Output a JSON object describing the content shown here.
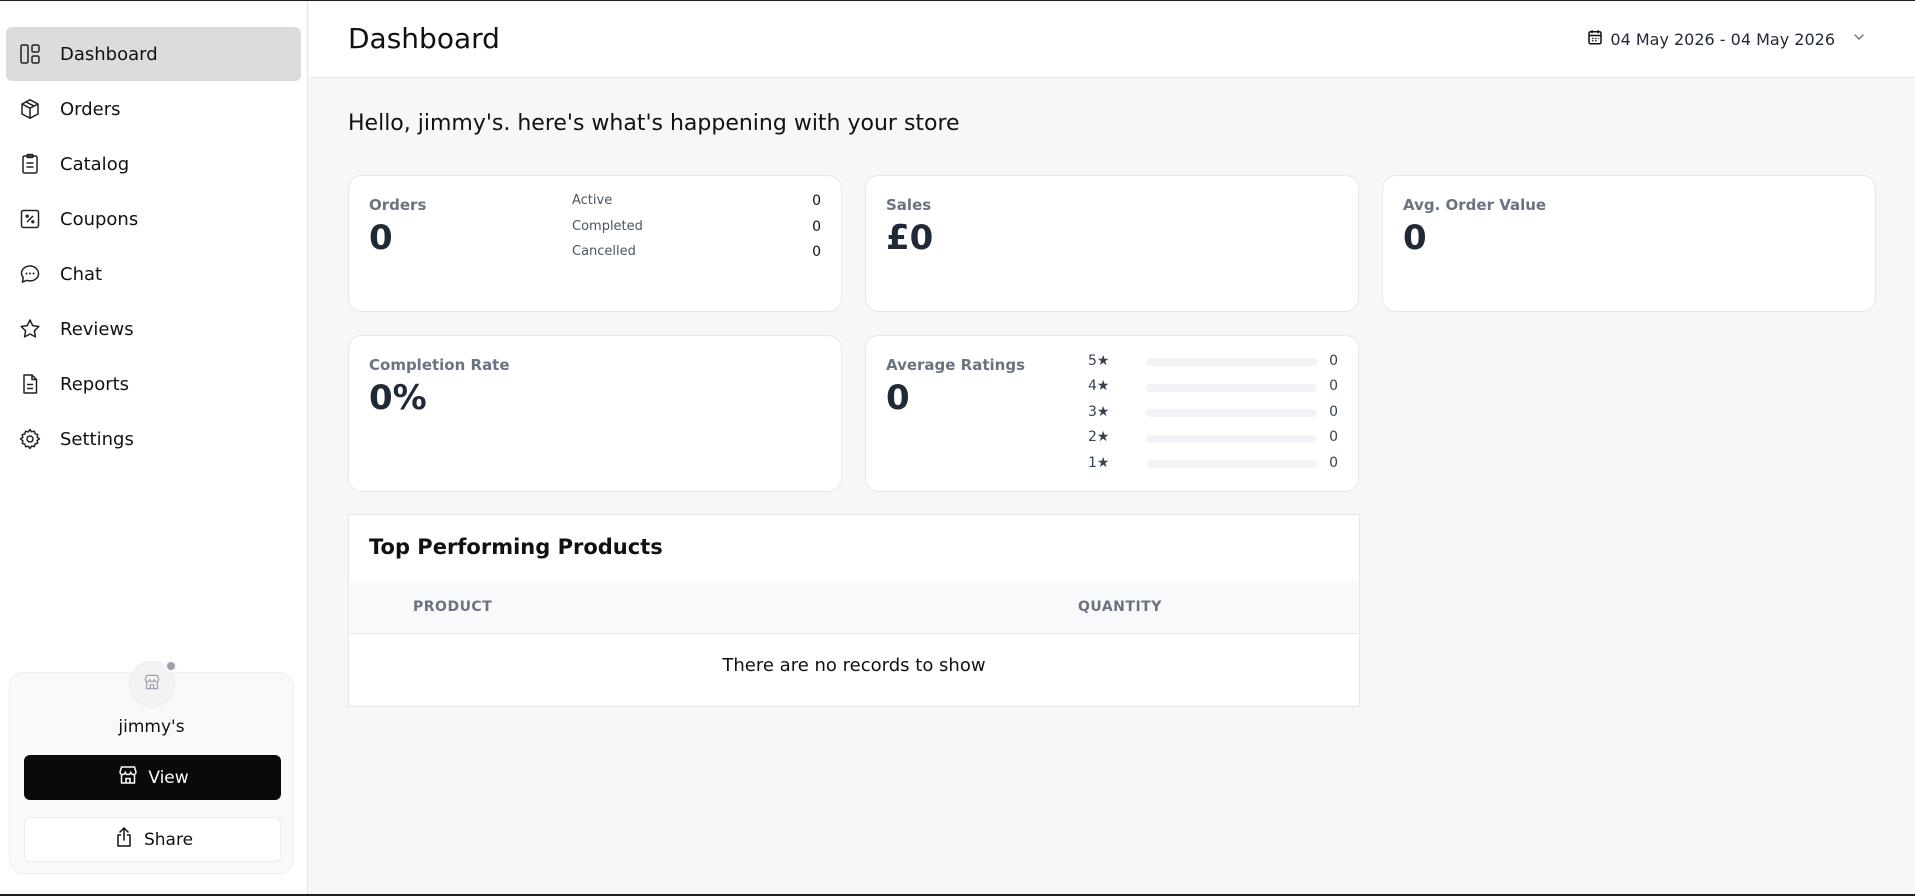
{
  "sidebar": {
    "items": [
      {
        "label": "Dashboard",
        "icon": "dashboard-icon",
        "active": true
      },
      {
        "label": "Orders",
        "icon": "box-icon"
      },
      {
        "label": "Catalog",
        "icon": "clipboard-icon"
      },
      {
        "label": "Coupons",
        "icon": "percent-icon"
      },
      {
        "label": "Chat",
        "icon": "chat-icon"
      },
      {
        "label": "Reviews",
        "icon": "star-icon"
      },
      {
        "label": "Reports",
        "icon": "document-icon"
      },
      {
        "label": "Settings",
        "icon": "gear-icon"
      }
    ],
    "store": {
      "name": "jimmy's",
      "view_label": "View",
      "share_label": "Share"
    }
  },
  "header": {
    "title": "Dashboard",
    "date_range": "04 May 2026 - 04 May 2026"
  },
  "greeting": "Hello, jimmy's. here's what's happening with your store",
  "stats": {
    "orders": {
      "label": "Orders",
      "value": "0",
      "breakdown": [
        {
          "label": "Active",
          "value": "0"
        },
        {
          "label": "Completed",
          "value": "0"
        },
        {
          "label": "Cancelled",
          "value": "0"
        }
      ]
    },
    "sales": {
      "label": "Sales",
      "value": "£0"
    },
    "avg_order_value": {
      "label": "Avg. Order Value",
      "value": "0"
    },
    "completion_rate": {
      "label": "Completion Rate",
      "value": "0%"
    },
    "average_ratings": {
      "label": "Average Ratings",
      "value": "0",
      "distribution": [
        {
          "stars": "5★",
          "count": "0",
          "fraction": 0
        },
        {
          "stars": "4★",
          "count": "0",
          "fraction": 0
        },
        {
          "stars": "3★",
          "count": "0",
          "fraction": 0
        },
        {
          "stars": "2★",
          "count": "0",
          "fraction": 0
        },
        {
          "stars": "1★",
          "count": "0",
          "fraction": 0
        }
      ]
    }
  },
  "top_products": {
    "title": "Top Performing Products",
    "columns": [
      "PRODUCT",
      "QUANTITY"
    ],
    "empty_message": "There are no records to show"
  }
}
